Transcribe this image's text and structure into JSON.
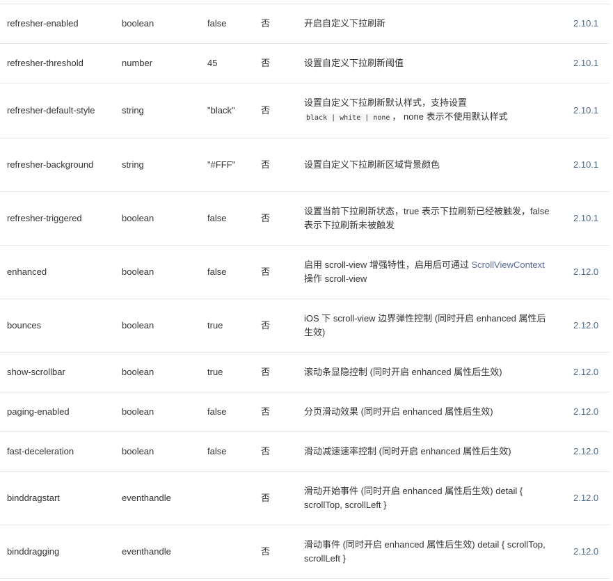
{
  "rows": [
    {
      "name": "refresher-enabled",
      "type": "boolean",
      "default": "false",
      "required": "否",
      "desc": "开启自定义下拉刷新",
      "version": "2.10.1"
    },
    {
      "name": "refresher-threshold",
      "type": "number",
      "default": "45",
      "required": "否",
      "desc": "设置自定义下拉刷新阈值",
      "version": "2.10.1"
    },
    {
      "name": "refresher-default-style",
      "type": "string",
      "default": "\"black\"",
      "required": "否",
      "desc": "设置自定义下拉刷新默认样式，支持设置",
      "desc_code": "black | white | none",
      "desc_after": "， none 表示不使用默认样式",
      "version": "2.10.1"
    },
    {
      "name": "refresher-background",
      "type": "string",
      "default": "\"#FFF\"",
      "required": "否",
      "desc": "设置自定义下拉刷新区域背景颜色",
      "version": "2.10.1"
    },
    {
      "name": "refresher-triggered",
      "type": "boolean",
      "default": "false",
      "required": "否",
      "desc": "设置当前下拉刷新状态，true 表示下拉刷新已经被触发，false 表示下拉刷新未被触发",
      "version": "2.10.1"
    },
    {
      "name": "enhanced",
      "type": "boolean",
      "default": "false",
      "required": "否",
      "desc": "启用 scroll-view 增强特性，启用后可通过 ",
      "desc_link": "ScrollViewContext",
      "desc_after": " 操作 scroll-view",
      "version": "2.12.0"
    },
    {
      "name": "bounces",
      "type": "boolean",
      "default": "true",
      "required": "否",
      "desc": "iOS 下 scroll-view 边界弹性控制 (同时开启 enhanced 属性后生效)",
      "version": "2.12.0"
    },
    {
      "name": "show-scrollbar",
      "type": "boolean",
      "default": "true",
      "required": "否",
      "desc": "滚动条显隐控制 (同时开启 enhanced 属性后生效)",
      "version": "2.12.0"
    },
    {
      "name": "paging-enabled",
      "type": "boolean",
      "default": "false",
      "required": "否",
      "desc": "分页滑动效果 (同时开启 enhanced 属性后生效)",
      "version": "2.12.0"
    },
    {
      "name": "fast-deceleration",
      "type": "boolean",
      "default": "false",
      "required": "否",
      "desc": "滑动减速速率控制 (同时开启 enhanced 属性后生效)",
      "version": "2.12.0"
    },
    {
      "name": "binddragstart",
      "type": "eventhandle",
      "default": "",
      "required": "否",
      "desc": "滑动开始事件 (同时开启 enhanced 属性后生效) detail { scrollTop, scrollLeft }",
      "version": "2.12.0"
    },
    {
      "name": "binddragging",
      "type": "eventhandle",
      "default": "",
      "required": "否",
      "desc": "滑动事件 (同时开启 enhanced 属性后生效) detail { scrollTop, scrollLeft }",
      "version": "2.12.0"
    }
  ]
}
